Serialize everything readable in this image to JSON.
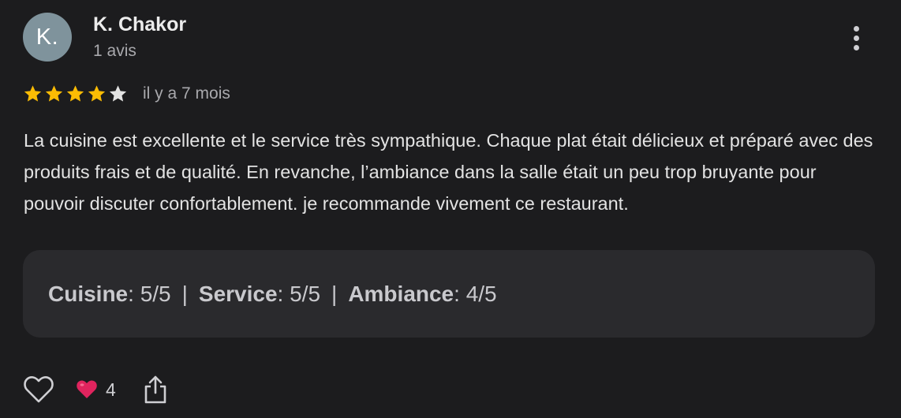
{
  "review": {
    "avatar_initial": "K.",
    "author_name": "K. Chakor",
    "review_count": "1 avis",
    "rating": 4,
    "rating_max": 5,
    "date": "il y a 7 mois",
    "text": "La cuisine est excellente et le service très sympathique. Chaque plat était délicieux et préparé avec des produits frais et de qualité. En revanche, l’ambiance dans la salle était un peu trop bruyante pour pouvoir discuter confortablement. je recommande vivement ce restaurant."
  },
  "ratings": [
    {
      "category": "Cuisine",
      "value": " : 5/5"
    },
    {
      "category": "Service",
      "value": " : 5/5"
    },
    {
      "category": "Ambiance",
      "value": " : 4/5"
    }
  ],
  "separator": "|",
  "actions": {
    "like_icon": "heart-outline-icon",
    "reaction_icon": "red-heart-emoji",
    "reaction_emoji": "❤️",
    "reaction_count": "4",
    "share_icon": "share-icon"
  },
  "colors": {
    "background": "#1c1c1e",
    "star_filled": "#fbbc04",
    "star_empty": "#e3e3e3",
    "avatar": "#7f939c",
    "ratings_box": "#2a2a2d",
    "heart": "#e0245e"
  }
}
